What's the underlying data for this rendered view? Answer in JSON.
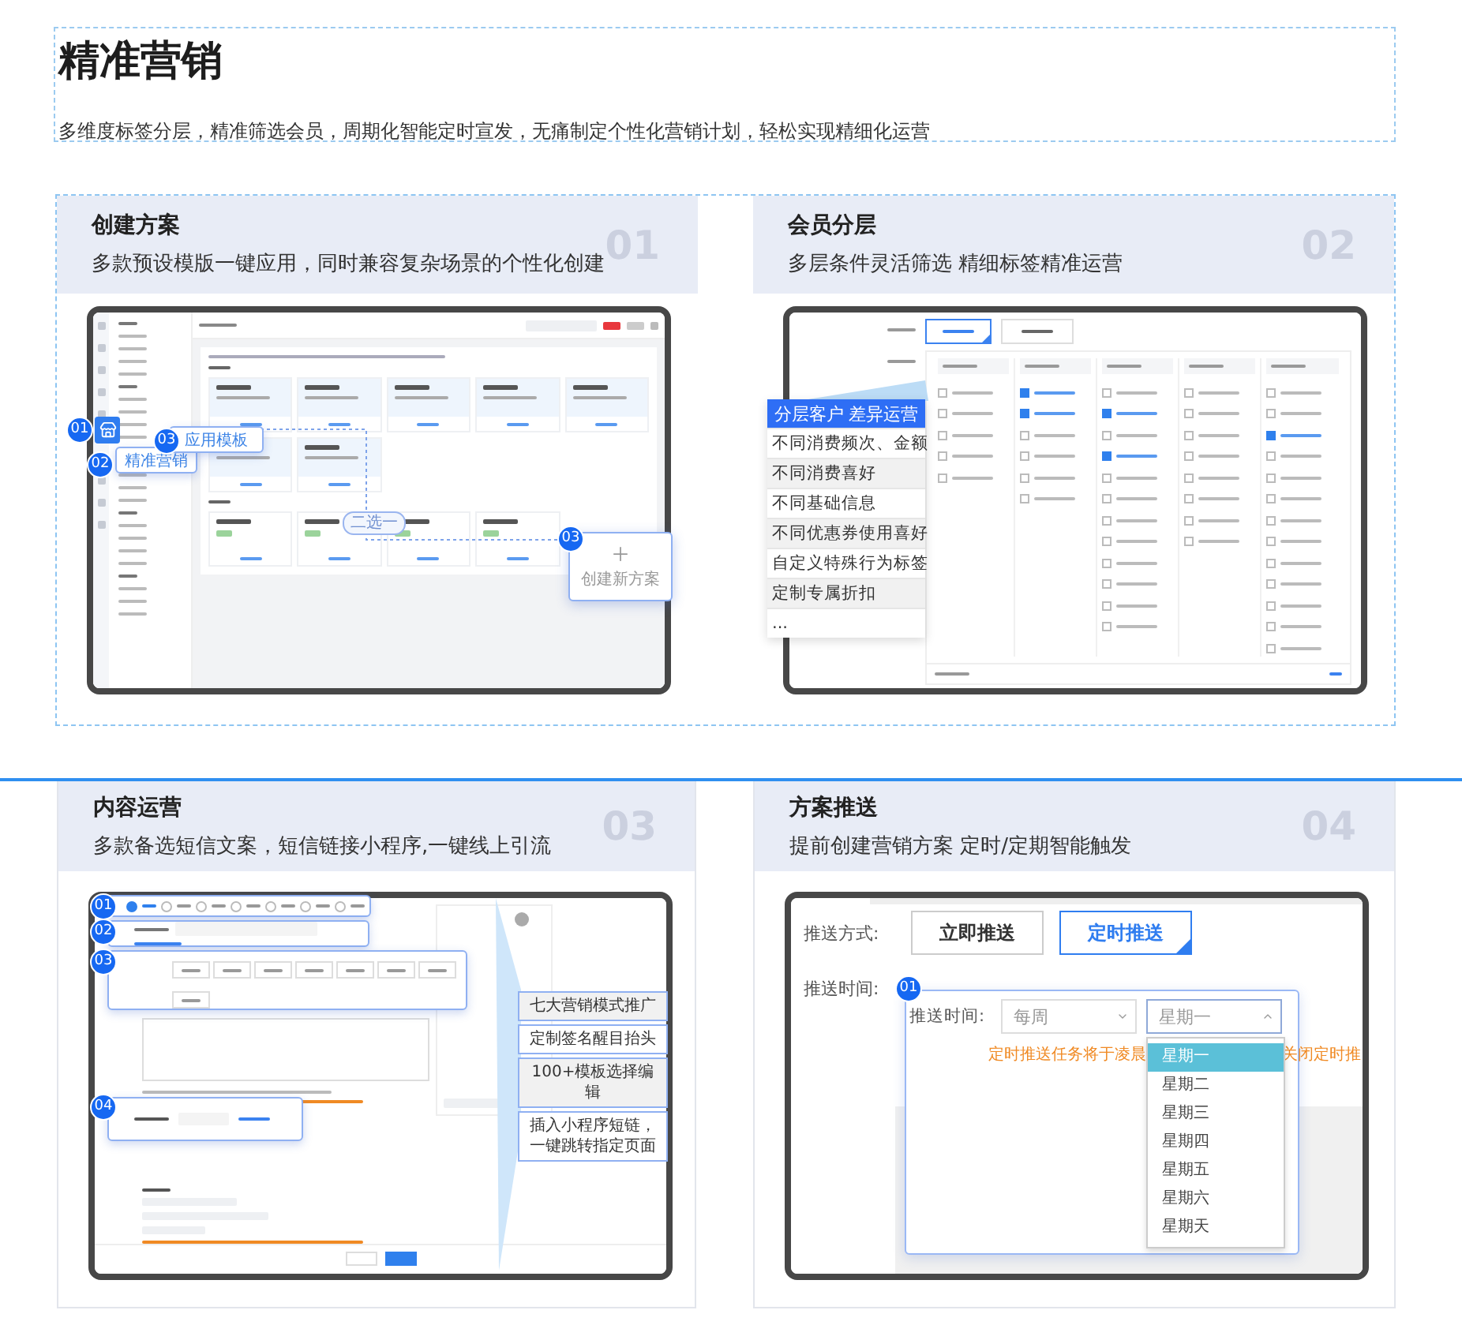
{
  "header": {
    "title": "精准营销",
    "subtitle": "多维度标签分层，精准筛选会员，周期化智能定时宣发，无痛制定个性化营销计划，轻松实现精细化运营"
  },
  "cards": [
    {
      "kind": "templates",
      "title": "创建方案",
      "subtitle": "多款预设模版一键应用，同时兼容复杂场景的个性化创建",
      "number": "01",
      "demo": {
        "menu_badge": "01",
        "menu_label_badge": "02",
        "menu_label": "精准营销",
        "apply_badge": "03",
        "apply_label": "应用模板",
        "choose_label": "二选一",
        "create_badge": "03",
        "create_label": "创建新方案"
      }
    },
    {
      "kind": "segments",
      "title": "会员分层",
      "subtitle": "多层条件灵活筛选 精细标签精准运营",
      "number": "02",
      "demo": {
        "tabs": [
          {
            "selected": true
          },
          {
            "selected": false
          }
        ],
        "columns": [
          {
            "items": [
              {
                "checked": false
              },
              {
                "checked": false
              },
              {
                "checked": false
              },
              {
                "checked": false
              },
              {
                "checked": false
              }
            ]
          },
          {
            "items": [
              {
                "checked": true
              },
              {
                "checked": true
              },
              {
                "checked": false
              },
              {
                "checked": false
              },
              {
                "checked": false
              },
              {
                "checked": false
              }
            ]
          },
          {
            "items": [
              {
                "checked": false
              },
              {
                "checked": true
              },
              {
                "checked": false
              },
              {
                "checked": true
              },
              {
                "checked": false
              },
              {
                "checked": false
              },
              {
                "checked": false
              },
              {
                "checked": false
              },
              {
                "checked": false
              },
              {
                "checked": false
              },
              {
                "checked": false
              },
              {
                "checked": false
              }
            ]
          },
          {
            "items": [
              {
                "checked": false
              },
              {
                "checked": false
              },
              {
                "checked": false
              },
              {
                "checked": false
              },
              {
                "checked": false
              },
              {
                "checked": false
              },
              {
                "checked": false
              },
              {
                "checked": false
              }
            ]
          },
          {
            "items": [
              {
                "checked": false
              },
              {
                "checked": false
              },
              {
                "checked": true
              },
              {
                "checked": false
              },
              {
                "checked": false
              },
              {
                "checked": false
              },
              {
                "checked": false
              },
              {
                "checked": false
              },
              {
                "checked": false
              },
              {
                "checked": false
              },
              {
                "checked": false
              },
              {
                "checked": false
              },
              {
                "checked": false
              }
            ]
          }
        ],
        "callout_heading": "分层客户 差异运营",
        "callout_items": [
          "不同消费频次、金额",
          "不同消费喜好",
          "不同基础信息",
          "不同优惠券使用喜好",
          "自定义特殊行为标签",
          "定制专属折扣",
          "..."
        ]
      }
    },
    {
      "kind": "content",
      "title": "内容运营",
      "subtitle": "多款备选短信文案，短信链接小程序,一键线上引流",
      "number": "03",
      "demo": {
        "badges": [
          "01",
          "02",
          "03",
          "04"
        ],
        "radios": [
          {
            "selected": true
          },
          {
            "selected": false
          },
          {
            "selected": false
          },
          {
            "selected": false
          },
          {
            "selected": false
          },
          {
            "selected": false
          },
          {
            "selected": false
          }
        ],
        "features": [
          "七大营销模式推广",
          "定制签名醒目抬头",
          "100+模板选择编辑",
          "插入小程序短链，一键跳转指定页面"
        ]
      }
    },
    {
      "kind": "push",
      "title": "方案推送",
      "subtitle": "提前创建营销方案 定时/定期智能触发",
      "number": "04",
      "demo": {
        "mode_label": "推送方式:",
        "modes": [
          {
            "label": "立即推送",
            "selected": false
          },
          {
            "label": "定时推送",
            "selected": true
          }
        ],
        "time_label": "推送时间:",
        "badge": "01",
        "inner_time_label": "推送时间:",
        "period": "每周",
        "day": "星期一",
        "hint": "定时推送任务将于凌晨",
        "hint_tail": "关闭定时推",
        "days": [
          {
            "label": "星期一",
            "selected": true
          },
          {
            "label": "星期二",
            "selected": false
          },
          {
            "label": "星期三",
            "selected": false
          },
          {
            "label": "星期四",
            "selected": false
          },
          {
            "label": "星期五",
            "selected": false
          },
          {
            "label": "星期六",
            "selected": false
          },
          {
            "label": "星期天",
            "selected": false
          }
        ]
      }
    }
  ]
}
